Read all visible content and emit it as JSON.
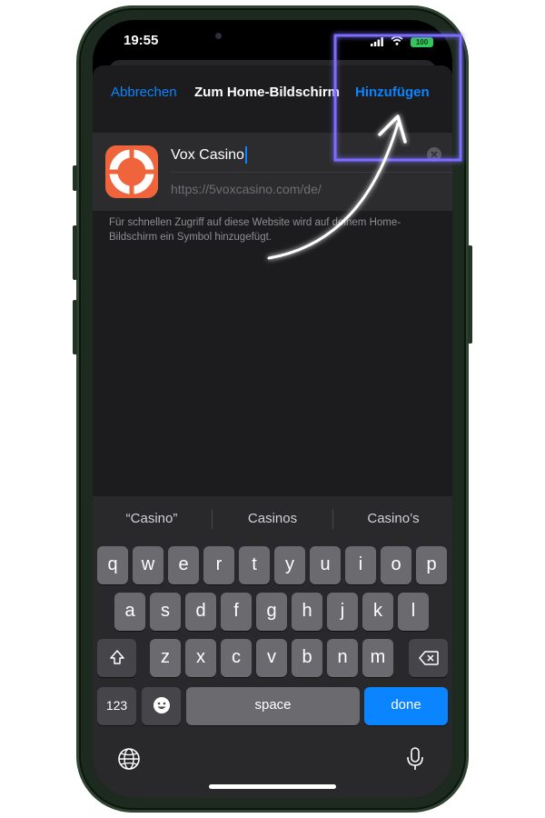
{
  "status_bar": {
    "time": "19:55",
    "battery": "100"
  },
  "nav": {
    "cancel_label": "Abbrechen",
    "title": "Zum Home-Bildschirm",
    "add_label": "Hinzufügen"
  },
  "bookmark": {
    "name": "Vox Casino",
    "url": "https://5voxcasino.com/de/",
    "hint": "Für schnellen Zugriff auf diese Website wird auf deinem Home-Bildschirm ein Symbol hinzugefügt."
  },
  "keyboard": {
    "suggestions": [
      "“Casino”",
      "Casinos",
      "Casino’s"
    ],
    "row1": [
      "q",
      "w",
      "e",
      "r",
      "t",
      "y",
      "u",
      "i",
      "o",
      "p"
    ],
    "row2": [
      "a",
      "s",
      "d",
      "f",
      "g",
      "h",
      "j",
      "k",
      "l"
    ],
    "row3": [
      "z",
      "x",
      "c",
      "v",
      "b",
      "n",
      "m"
    ],
    "numbers_label": "123",
    "space_label": "space",
    "done_label": "done"
  },
  "icons": {
    "app_icon": "lifebuoy-icon",
    "shift": "shift-icon",
    "backspace": "backspace-icon",
    "emoji": "emoji-icon",
    "globe": "globe-icon",
    "dictation": "microphone-icon"
  },
  "colors": {
    "accent": "#0a84ff",
    "highlight": "#6a5cff",
    "app_icon": "#f0643c"
  }
}
